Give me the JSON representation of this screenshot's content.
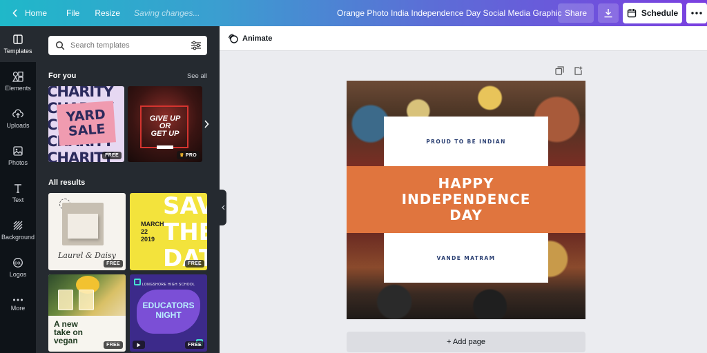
{
  "topbar": {
    "home": "Home",
    "file": "File",
    "resize": "Resize",
    "saving": "Saving changes...",
    "title": "Orange Photo India Independence Day Social Media Graphic",
    "share": "Share",
    "schedule": "Schedule"
  },
  "rail": [
    {
      "label": "Templates",
      "icon": "templates-icon",
      "active": true
    },
    {
      "label": "Elements",
      "icon": "elements-icon"
    },
    {
      "label": "Uploads",
      "icon": "upload-icon"
    },
    {
      "label": "Photos",
      "icon": "photo-icon"
    },
    {
      "label": "Text",
      "icon": "text-icon"
    },
    {
      "label": "Background",
      "icon": "background-icon"
    },
    {
      "label": "Logos",
      "icon": "logo-icon"
    },
    {
      "label": "More",
      "icon": "more-icon"
    }
  ],
  "panel": {
    "search_placeholder": "Search templates",
    "for_you": "For you",
    "see_all": "See all",
    "all_results": "All results",
    "templates": {
      "charity": {
        "rows": "CHARITY",
        "yard": "YARD",
        "sale": "SALE",
        "badge": "FREE"
      },
      "giveup": {
        "line1": "GIVE UP",
        "line2": "OR",
        "line3": "GET UP",
        "badge": "PRO"
      },
      "laurel": {
        "title": "Laurel & Daisy",
        "badge": "FREE"
      },
      "save": {
        "big1": "SAVE",
        "big2": "THE",
        "big3": "DATE",
        "month": "MARCH",
        "day": "22",
        "year": "2019",
        "badge": "FREE"
      },
      "vegan": {
        "line1": "A new",
        "line2": "take on",
        "line3": "vegan",
        "badge": "FREE"
      },
      "edu": {
        "school": "LONGSHORE HIGH SCHOOL",
        "line1": "EDUCATORS",
        "line2": "NIGHT",
        "badge": "FREE"
      }
    }
  },
  "toolbar": {
    "animate": "Animate"
  },
  "design": {
    "top_text": "PROUD TO BE INDIAN",
    "heading1": "HAPPY",
    "heading2": "INDEPENDENCE",
    "heading3": "DAY",
    "bottom_text": "VANDE MATRAM",
    "accent": "#e0753e"
  },
  "add_page": "+ Add page"
}
